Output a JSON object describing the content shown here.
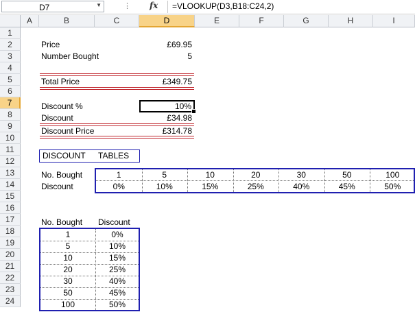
{
  "formula_bar": {
    "name_box": "D7",
    "fx_label": "fx",
    "formula": "=VLOOKUP(D3,B18:C24,2)"
  },
  "columns": [
    "A",
    "B",
    "C",
    "D",
    "E",
    "F",
    "G",
    "H",
    "I"
  ],
  "selected_column": "D",
  "rows": [
    "1",
    "2",
    "3",
    "4",
    "5",
    "6",
    "7",
    "8",
    "9",
    "10",
    "11",
    "12",
    "13",
    "14",
    "15",
    "16",
    "17",
    "18",
    "19",
    "20",
    "21",
    "22",
    "23",
    "24"
  ],
  "selected_row": "7",
  "summary": {
    "price_label": "Price",
    "price_value": "£69.95",
    "bought_label": "Number Bought",
    "bought_value": "5",
    "total_label": "Total Price",
    "total_value": "£349.75",
    "discount_pct_label": "Discount %",
    "discount_pct_value": "10%",
    "discount_label": "Discount",
    "discount_value": "£34.98",
    "discount_price_label": "Discount Price",
    "discount_price_value": "£314.78"
  },
  "tables_heading": {
    "left": "DISCOUNT",
    "right": "TABLES"
  },
  "horizontal_table": {
    "row1_label": "No. Bought",
    "row2_label": "Discount",
    "quantities": [
      "1",
      "5",
      "10",
      "20",
      "30",
      "50",
      "100"
    ],
    "discounts": [
      "0%",
      "10%",
      "15%",
      "25%",
      "40%",
      "45%",
      "50%"
    ]
  },
  "vertical_table": {
    "header_qty": "No. Bought",
    "header_disc": "Discount",
    "quantities": [
      "1",
      "5",
      "10",
      "20",
      "30",
      "50",
      "100"
    ],
    "discounts": [
      "0%",
      "10%",
      "15%",
      "25%",
      "40%",
      "45%",
      "50%"
    ]
  },
  "colors": {
    "accent_border": "#1f1fb0",
    "total_rule": "#c0262d",
    "selected_header": "#f8d388"
  }
}
